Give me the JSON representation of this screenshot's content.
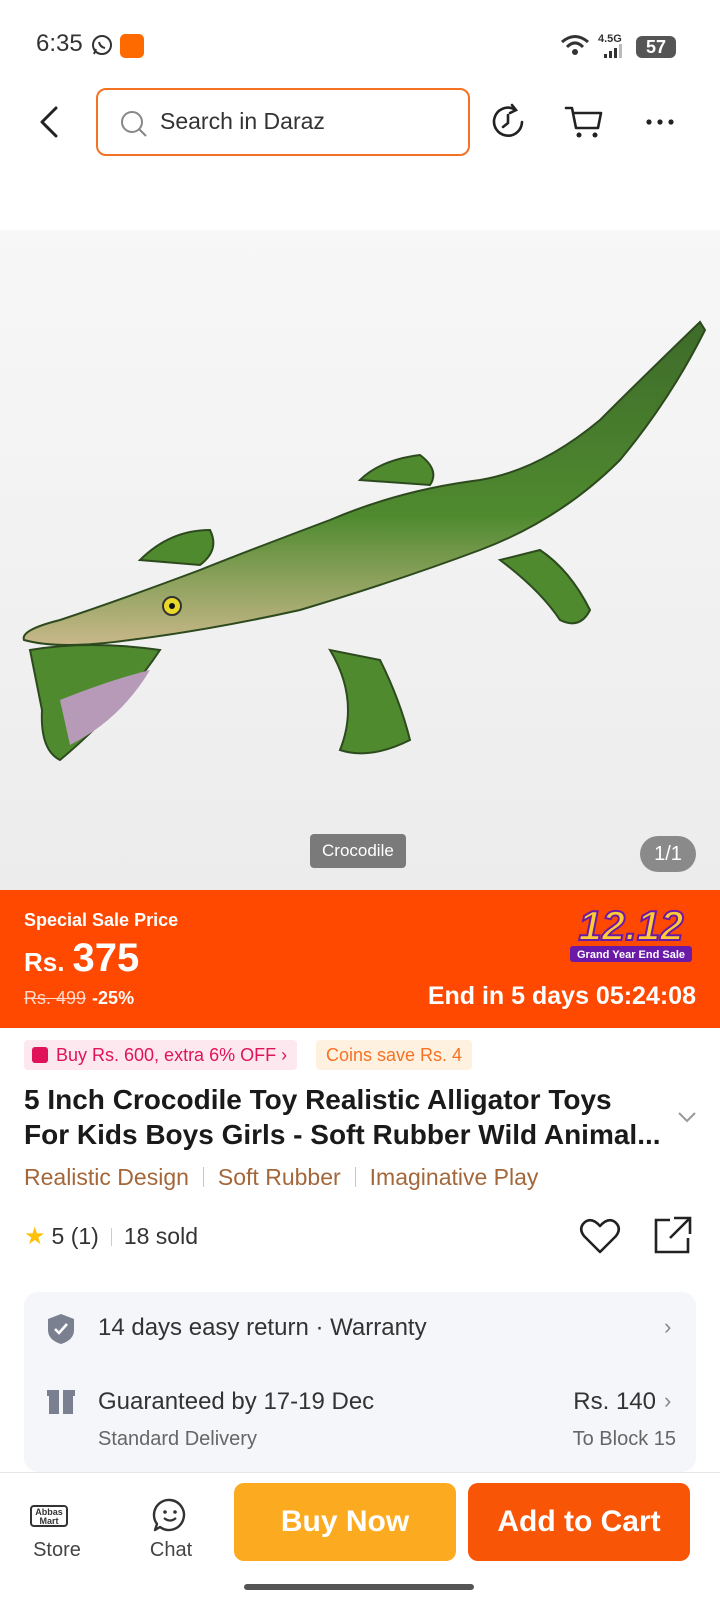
{
  "status_bar": {
    "time": "6:35",
    "network": "4.5G",
    "battery": "57"
  },
  "nav": {
    "search_placeholder": "Search in Daraz",
    "icons": [
      "back-icon",
      "search-icon",
      "history-icon",
      "cart-icon",
      "more-icon"
    ]
  },
  "gallery": {
    "variant_tag": "Crocodile",
    "counter": "1/1"
  },
  "sale": {
    "label": "Special Sale Price",
    "currency": "Rs.",
    "price": "375",
    "original_price": "Rs. 499",
    "discount": "-25%",
    "countdown": "End in 5 days 05:24:08",
    "event_title": "12.12",
    "event_subtitle": "Grand Year End Sale"
  },
  "promos": {
    "voucher": "Buy Rs. 600, extra 6% OFF",
    "coins": "Coins save Rs. 4"
  },
  "product": {
    "title": "5 Inch Crocodile Toy Realistic Alligator Toys For Kids Boys Girls - Soft Rubber Wild Animal...",
    "features": [
      "Realistic Design",
      "Soft Rubber",
      "Imaginative Play"
    ],
    "rating": "5",
    "rating_count": "(1)",
    "sold": "18 sold"
  },
  "services": {
    "return": "14 days easy return",
    "dot": "·",
    "warranty": "Warranty",
    "delivery_title": "Guaranteed by 17-19 Dec",
    "delivery_type": "Standard Delivery",
    "delivery_price": "Rs. 140",
    "delivery_location": "To Block 15"
  },
  "bottom_bar": {
    "store_label": "Store",
    "store_logo_text": "Abbas Mart",
    "chat_label": "Chat",
    "buy_now": "Buy Now",
    "add_to_cart": "Add to Cart"
  },
  "colors": {
    "accent": "#f57224",
    "sale_banner": "#ff4800",
    "buy_now": "#fcab20",
    "add_to_cart": "#f85606",
    "feature_tag": "#a4673a"
  }
}
